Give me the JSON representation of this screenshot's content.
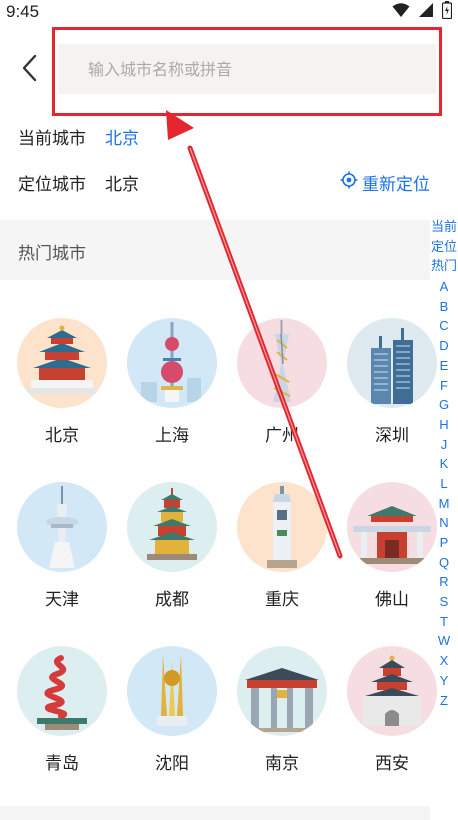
{
  "status_bar": {
    "time": "9:45",
    "icons": [
      "wifi-icon",
      "signal-icon",
      "battery-icon"
    ]
  },
  "header": {
    "back_icon": "chevron-left-icon",
    "search_placeholder": "输入城市名称或拼音",
    "search_value": ""
  },
  "current_city": {
    "label": "当前城市",
    "value": "北京"
  },
  "located_city": {
    "label": "定位城市",
    "value": "北京",
    "relocate_label": "重新定位",
    "relocate_icon": "locate-icon"
  },
  "hot_cities": {
    "title": "热门城市",
    "cities": [
      {
        "name": "北京",
        "icon": "temple-of-heaven-icon",
        "bg": "#fde2cc"
      },
      {
        "name": "上海",
        "icon": "oriental-pearl-tower-icon",
        "bg": "#d3e8f6"
      },
      {
        "name": "广州",
        "icon": "canton-tower-icon",
        "bg": "#f6dde2"
      },
      {
        "name": "深圳",
        "icon": "skyscraper-icon",
        "bg": "#dfeaf0"
      },
      {
        "name": "天津",
        "icon": "tianjin-tower-icon",
        "bg": "#d3e8f6"
      },
      {
        "name": "成都",
        "icon": "pagoda-icon",
        "bg": "#ddeef0"
      },
      {
        "name": "重庆",
        "icon": "liberation-monument-icon",
        "bg": "#fde2cc"
      },
      {
        "name": "佛山",
        "icon": "ancestral-temple-icon",
        "bg": "#f6dde2"
      },
      {
        "name": "青岛",
        "icon": "may-wind-sculpture-icon",
        "bg": "#ddeef0"
      },
      {
        "name": "沈阳",
        "icon": "golden-sculpture-icon",
        "bg": "#d3e8f6"
      },
      {
        "name": "南京",
        "icon": "city-gate-icon",
        "bg": "#ddeef0"
      },
      {
        "name": "西安",
        "icon": "bell-tower-icon",
        "bg": "#f6dde2"
      }
    ]
  },
  "index_bar": {
    "items": [
      "当前",
      "定位",
      "热门",
      "A",
      "B",
      "C",
      "D",
      "E",
      "F",
      "G",
      "H",
      "J",
      "K",
      "L",
      "M",
      "N",
      "P",
      "Q",
      "R",
      "S",
      "T",
      "W",
      "X",
      "Y",
      "Z"
    ]
  },
  "colors": {
    "accent": "#1a73e8",
    "annotation_red": "#e3262f",
    "section_bg": "#f5f5f5",
    "search_bg": "#f4f3f1"
  }
}
